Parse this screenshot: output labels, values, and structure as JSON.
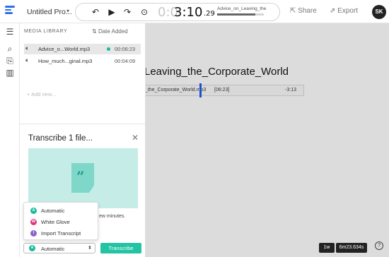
{
  "header": {
    "doc_title": "Untitled Pro...",
    "timecode_dim": "0:0",
    "timecode_main": "3:10",
    "timecode_frac": ".29",
    "track_name": "Advice_on_Leaving_the",
    "track_progress": 0.82,
    "share_label": "Share",
    "export_label": "Export",
    "avatar_initials": "SK"
  },
  "library": {
    "heading": "MEDIA LIBRARY",
    "sort_label": "Date Added",
    "items": [
      {
        "name": "Advice_o...World.mp3",
        "duration": "00:06:23",
        "selected": true
      },
      {
        "name": "How_much...ginal.mp3",
        "duration": "00:04:09",
        "selected": false
      }
    ],
    "add_label": "Add new..."
  },
  "editor": {
    "title": "Leaving_the_Corporate_World",
    "clip_name": "_the_Corporate_World.mp3",
    "clip_duration": "[06:23]",
    "clip_end": "-3:13"
  },
  "transcribe": {
    "title": "Transcribe 1 file...",
    "note": "ew minutes.",
    "selected_option": "Automatic",
    "button_label": "Transcribe",
    "options": [
      {
        "label": "Automatic",
        "badge": "A",
        "color": "#19b99a"
      },
      {
        "label": "White Glove",
        "badge": "W",
        "color": "#e0357a"
      },
      {
        "label": "Import Transcript",
        "badge": "I",
        "color": "#8a63d2"
      }
    ]
  },
  "footer": {
    "zoom_level": "1w",
    "total_time": "6m23.634s",
    "help": "?"
  }
}
